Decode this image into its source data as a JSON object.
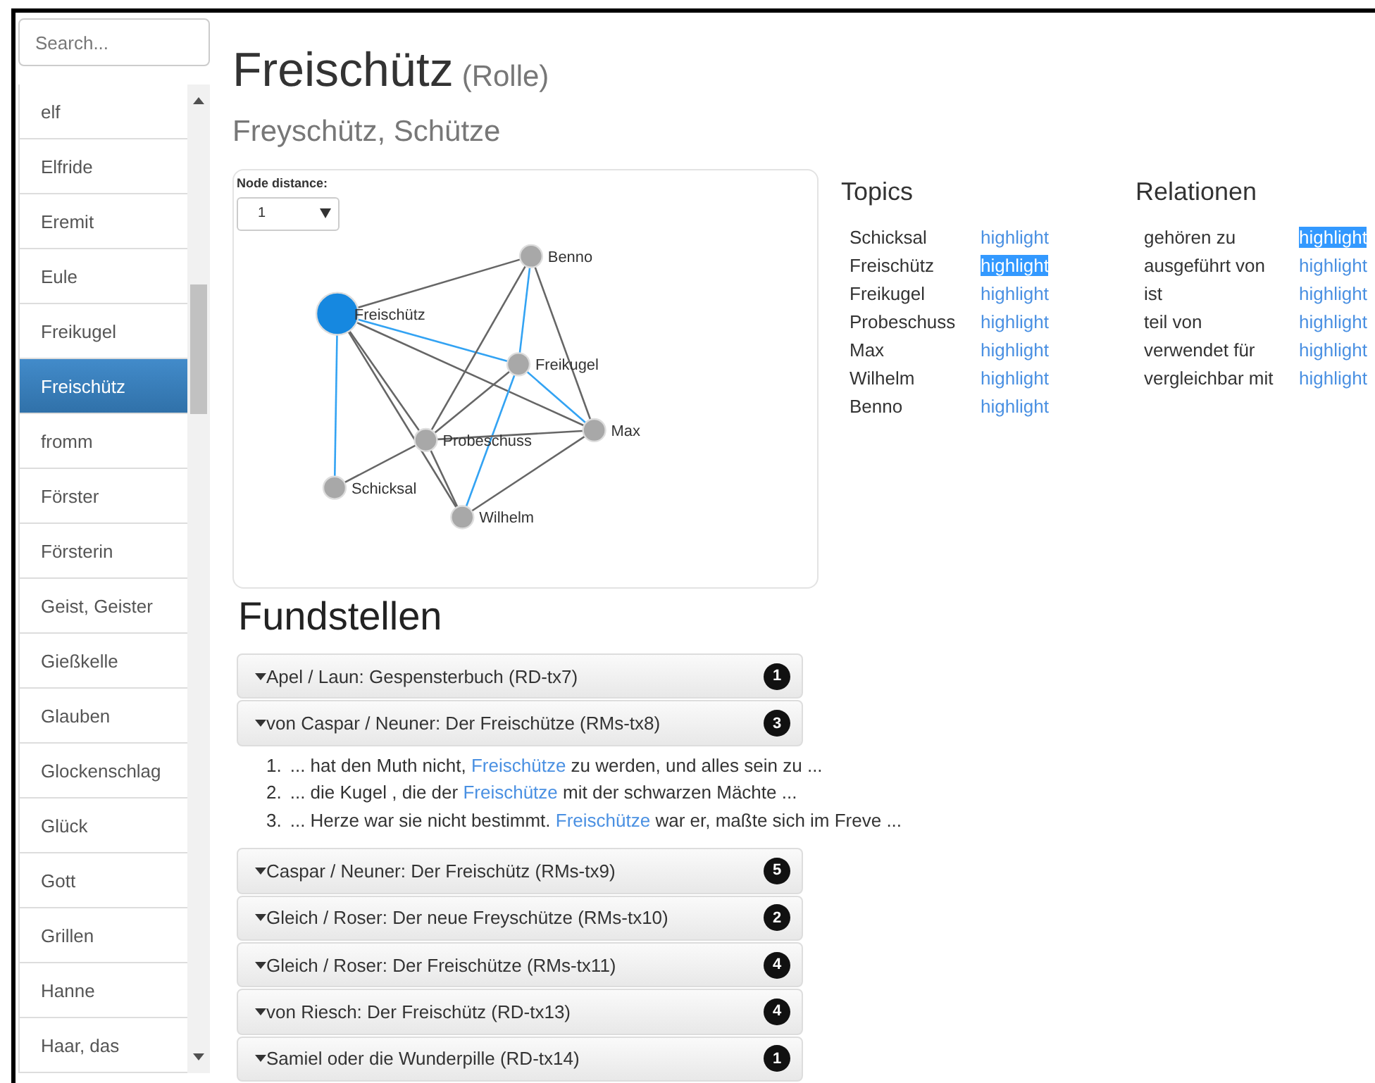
{
  "search": {
    "placeholder": "Search..."
  },
  "sidebar": {
    "items": [
      {
        "label": "elf",
        "selected": false
      },
      {
        "label": "Elfride",
        "selected": false
      },
      {
        "label": "Eremit",
        "selected": false
      },
      {
        "label": "Eule",
        "selected": false
      },
      {
        "label": "Freikugel",
        "selected": false
      },
      {
        "label": "Freischütz",
        "selected": true
      },
      {
        "label": "fromm",
        "selected": false
      },
      {
        "label": "Förster",
        "selected": false
      },
      {
        "label": "Försterin",
        "selected": false
      },
      {
        "label": "Geist, Geister",
        "selected": false
      },
      {
        "label": "Gießkelle",
        "selected": false
      },
      {
        "label": "Glauben",
        "selected": false
      },
      {
        "label": "Glockenschlag",
        "selected": false
      },
      {
        "label": "Glück",
        "selected": false
      },
      {
        "label": "Gott",
        "selected": false
      },
      {
        "label": "Grillen",
        "selected": false
      },
      {
        "label": "Hanne",
        "selected": false
      },
      {
        "label": "Haar, das",
        "selected": false
      }
    ]
  },
  "title": "Freischütz",
  "title_type": "(Rolle)",
  "subtitle": "Freyschütz, Schütze",
  "graph": {
    "distance_label": "Node distance:",
    "distance_value": "1",
    "nodes": [
      {
        "label": "Freischütz",
        "selected": true
      },
      {
        "label": "Benno",
        "selected": false
      },
      {
        "label": "Freikugel",
        "selected": false
      },
      {
        "label": "Max",
        "selected": false
      },
      {
        "label": "Probeschuss",
        "selected": false
      },
      {
        "label": "Schicksal",
        "selected": false
      },
      {
        "label": "Wilhelm",
        "selected": false
      }
    ],
    "edges": [
      {
        "highlighted": false
      },
      {
        "highlighted": true
      },
      {
        "highlighted": false
      },
      {
        "highlighted": false
      },
      {
        "highlighted": false
      },
      {
        "highlighted": true
      },
      {
        "highlighted": false
      },
      {
        "highlighted": true
      },
      {
        "highlighted": false
      },
      {
        "highlighted": false
      },
      {
        "highlighted": true
      },
      {
        "highlighted": true
      },
      {
        "highlighted": false
      },
      {
        "highlighted": false
      },
      {
        "highlighted": false
      },
      {
        "highlighted": false
      }
    ]
  },
  "topics": {
    "title": "Topics",
    "rows": [
      {
        "label": "Schicksal",
        "action": "highlight",
        "selected": false
      },
      {
        "label": "Freischütz",
        "action": "highlight",
        "selected": true
      },
      {
        "label": "Freikugel",
        "action": "highlight",
        "selected": false
      },
      {
        "label": "Probeschuss",
        "action": "highlight",
        "selected": false
      },
      {
        "label": "Max",
        "action": "highlight",
        "selected": false
      },
      {
        "label": "Wilhelm",
        "action": "highlight",
        "selected": false
      },
      {
        "label": "Benno",
        "action": "highlight",
        "selected": false
      }
    ]
  },
  "relations": {
    "title": "Relationen",
    "rows": [
      {
        "label": "gehören zu",
        "action": "highlight",
        "selected": true
      },
      {
        "label": "ausgeführt von",
        "action": "highlight",
        "selected": false
      },
      {
        "label": "ist",
        "action": "highlight",
        "selected": false
      },
      {
        "label": "teil von",
        "action": "highlight",
        "selected": false
      },
      {
        "label": "verwendet für",
        "action": "highlight",
        "selected": false
      },
      {
        "label": "vergleichbar mit",
        "action": "highlight",
        "selected": false
      }
    ]
  },
  "findings": {
    "title": "Fundstellen",
    "panels": [
      {
        "title": "Apel / Laun: Gespensterbuch (RD-tx7)",
        "count": "1",
        "expanded": false
      },
      {
        "title": "von Caspar / Neuner: Der Freischütze (RMs-tx8)",
        "count": "3",
        "expanded": true,
        "snippets": [
          {
            "number": "1.",
            "before": "... hat den Muth nicht, ",
            "term": "Freischütze",
            "after": " zu werden, und alles sein zu ..."
          },
          {
            "number": "2.",
            "before": "... die Kugel , die der ",
            "term": "Freischütze",
            "after": " mit der schwarzen Mächte ..."
          },
          {
            "number": "3.",
            "before": "... Herze war sie nicht bestimmt. ",
            "term": "Freischütze",
            "after": " war er, maßte sich im Freve ..."
          }
        ]
      },
      {
        "title": "Caspar / Neuner: Der Freischütz (RMs-tx9)",
        "count": "5",
        "expanded": false
      },
      {
        "title": "Gleich / Roser: Der neue Freyschütze (RMs-tx10)",
        "count": "2",
        "expanded": false
      },
      {
        "title": "Gleich / Roser: Der Freischütze (RMs-tx11)",
        "count": "4",
        "expanded": false
      },
      {
        "title": "von Riesch: Der Freischütz (RD-tx13)",
        "count": "4",
        "expanded": false
      },
      {
        "title": "Samiel oder die Wunderpille (RD-tx14)",
        "count": "1",
        "expanded": false
      }
    ]
  }
}
